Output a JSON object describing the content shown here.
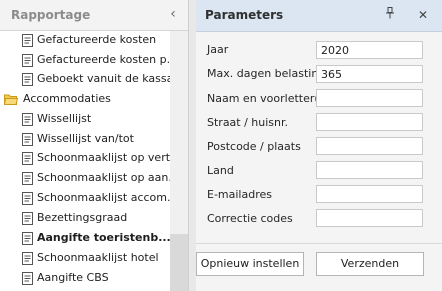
{
  "left_panel": {
    "title": "Rapportage",
    "collapse_icon": "chevron-left-icon",
    "items": [
      {
        "label": "Gefactureerde kosten",
        "type": "report",
        "bold": false
      },
      {
        "label": "Gefactureerde kosten p...",
        "type": "report",
        "bold": false
      },
      {
        "label": "Geboekt vanuit de kassa",
        "type": "report",
        "bold": false
      },
      {
        "label": "Accommodaties",
        "type": "folder",
        "bold": false
      },
      {
        "label": "Wissellijst",
        "type": "report",
        "bold": false
      },
      {
        "label": "Wissellijst van/tot",
        "type": "report",
        "bold": false
      },
      {
        "label": "Schoonmaaklijst op vert...",
        "type": "report",
        "bold": false
      },
      {
        "label": "Schoonmaaklijst op aan...",
        "type": "report",
        "bold": false
      },
      {
        "label": "Schoonmaaklijst accom...",
        "type": "report",
        "bold": false
      },
      {
        "label": "Bezettingsgraad",
        "type": "report",
        "bold": false
      },
      {
        "label": "Aangifte toeristenb...",
        "type": "report",
        "bold": true
      },
      {
        "label": "Schoonmaaklijst hotel",
        "type": "report",
        "bold": false
      },
      {
        "label": "Aangifte CBS",
        "type": "report",
        "bold": false
      }
    ]
  },
  "right_panel": {
    "title": "Parameters",
    "pin_icon": "pin-icon",
    "close_icon": "close-icon",
    "fields": [
      {
        "label": "Jaar",
        "value": "2020"
      },
      {
        "label": "Max. dagen belasting",
        "value": "365"
      },
      {
        "label": "Naam en voorletter(s)",
        "value": ""
      },
      {
        "label": "Straat / huisnr.",
        "value": ""
      },
      {
        "label": "Postcode / plaats",
        "value": ""
      },
      {
        "label": "Land",
        "value": ""
      },
      {
        "label": "E-mailadres",
        "value": ""
      },
      {
        "label": "Correctie codes",
        "value": ""
      }
    ],
    "buttons": {
      "reset": "Opnieuw instellen",
      "send": "Verzenden"
    }
  },
  "colors": {
    "header_blue": "#dbe6f2",
    "folder": "#f2c94c"
  }
}
